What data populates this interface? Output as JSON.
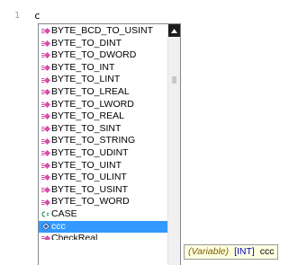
{
  "editor": {
    "line_number": "1",
    "typed_text": "c"
  },
  "autocomplete": {
    "items": [
      {
        "label": "BYTE_BCD_TO_USINT",
        "icon": "conversion-function-icon"
      },
      {
        "label": "BYTE_TO_DINT",
        "icon": "conversion-function-icon"
      },
      {
        "label": "BYTE_TO_DWORD",
        "icon": "conversion-function-icon"
      },
      {
        "label": "BYTE_TO_INT",
        "icon": "conversion-function-icon"
      },
      {
        "label": "BYTE_TO_LINT",
        "icon": "conversion-function-icon"
      },
      {
        "label": "BYTE_TO_LREAL",
        "icon": "conversion-function-icon"
      },
      {
        "label": "BYTE_TO_LWORD",
        "icon": "conversion-function-icon"
      },
      {
        "label": "BYTE_TO_REAL",
        "icon": "conversion-function-icon"
      },
      {
        "label": "BYTE_TO_SINT",
        "icon": "conversion-function-icon"
      },
      {
        "label": "BYTE_TO_STRING",
        "icon": "conversion-function-icon"
      },
      {
        "label": "BYTE_TO_UDINT",
        "icon": "conversion-function-icon"
      },
      {
        "label": "BYTE_TO_UINT",
        "icon": "conversion-function-icon"
      },
      {
        "label": "BYTE_TO_ULINT",
        "icon": "conversion-function-icon"
      },
      {
        "label": "BYTE_TO_USINT",
        "icon": "conversion-function-icon"
      },
      {
        "label": "BYTE_TO_WORD",
        "icon": "conversion-function-icon"
      },
      {
        "label": "CASE",
        "icon": "keyword-icon"
      },
      {
        "label": "ccc",
        "icon": "variable-icon"
      },
      {
        "label": "CheckReal",
        "icon": "conversion-function-icon"
      }
    ],
    "selected_index": 16
  },
  "tooltip": {
    "kind": "(Variable)",
    "type": "[INT]",
    "name": "ccc"
  },
  "colors": {
    "selection": "#3399ff",
    "function_icon": "#d64fa8",
    "keyword_icon": "#3a9a5a",
    "variable_icon": "#2a5fb0",
    "tooltip_bg": "#ffffe1"
  }
}
